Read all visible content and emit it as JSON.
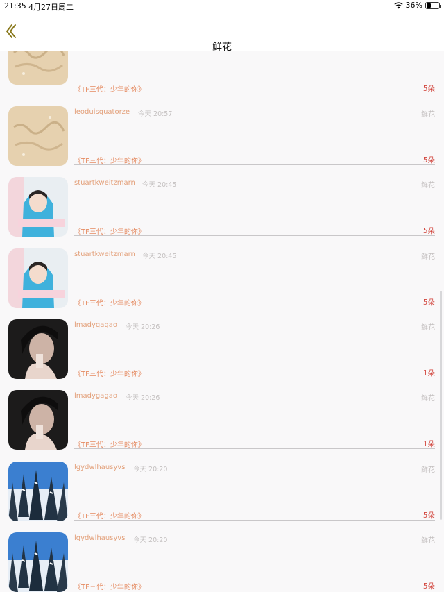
{
  "status_bar": {
    "time": "21:35",
    "date": "4月27日周二",
    "battery": "36%",
    "battery_level": 0.36
  },
  "nav": {
    "title": "鲜花",
    "back_icon": "chevron-left-icon"
  },
  "list": [
    {
      "user": "",
      "time": "",
      "type": "",
      "work": "《TF三代：少年的你》",
      "count": "5朵",
      "avatar": "sand-writing"
    },
    {
      "user": "leoduisquatorze",
      "time": "今天 20:57",
      "type": "鲜花",
      "work": "《TF三代：少年的你》",
      "count": "5朵",
      "avatar": "sand-writing"
    },
    {
      "user": "stuartkweitzmarn",
      "time": "今天 20:45",
      "type": "鲜花",
      "work": "《TF三代：少年的你》",
      "count": "5朵",
      "avatar": "blue-hoodie"
    },
    {
      "user": "stuartkweitzmarn",
      "time": "今天 20:45",
      "type": "鲜花",
      "work": "《TF三代：少年的你》",
      "count": "5朵",
      "avatar": "blue-hoodie"
    },
    {
      "user": "lmadygagao",
      "time": "今天 20:26",
      "type": "鲜花",
      "work": "《TF三代：少年的你》",
      "count": "1朵",
      "avatar": "dark-portrait"
    },
    {
      "user": "lmadygagao",
      "time": "今天 20:26",
      "type": "鲜花",
      "work": "《TF三代：少年的你》",
      "count": "1朵",
      "avatar": "dark-portrait"
    },
    {
      "user": "lgydwlhausyvs",
      "time": "今天 20:20",
      "type": "鲜花",
      "work": "《TF三代：少年的你》",
      "count": "5朵",
      "avatar": "snowy-trees"
    },
    {
      "user": "lgydwlhausyvs",
      "time": "今天 20:20",
      "type": "鲜花",
      "work": "《TF三代：少年的你》",
      "count": "5朵",
      "avatar": "snowy-trees"
    }
  ],
  "colors": {
    "username": "#e3a07a",
    "work_title": "#e58b62",
    "count": "#d2453d",
    "muted": "#c4c0c0",
    "back_arrow": "#8a7a1e"
  }
}
